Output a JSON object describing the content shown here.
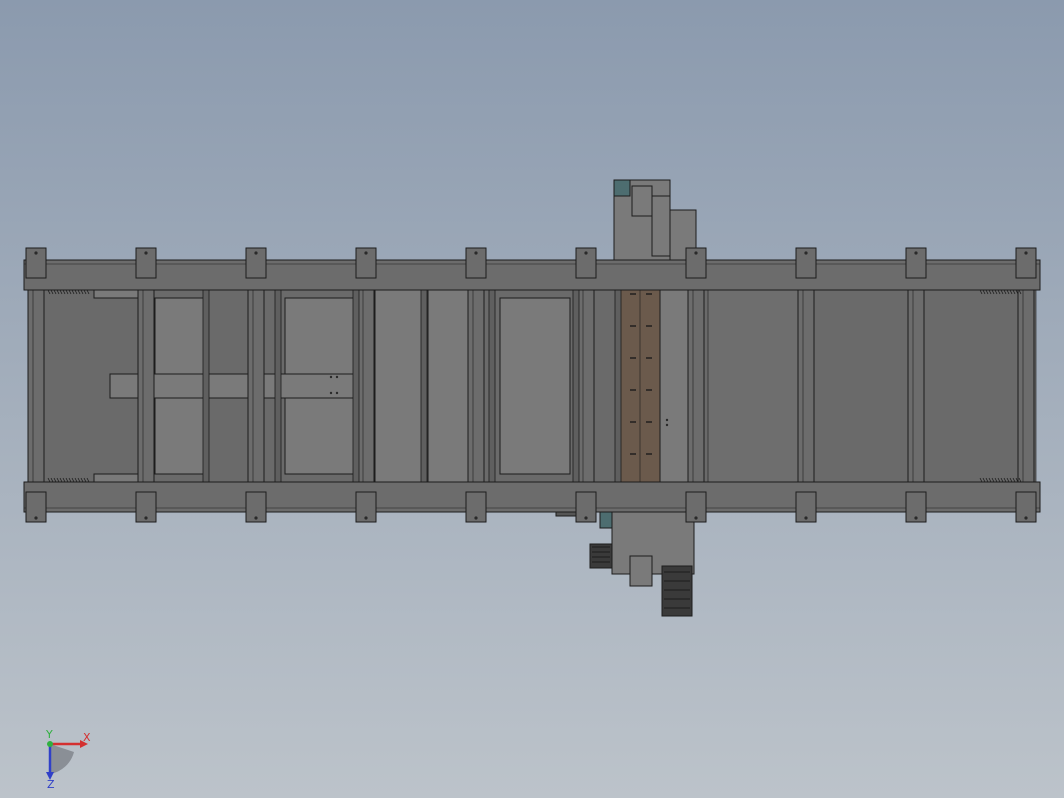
{
  "viewport": {
    "background_top": "#8b9aae",
    "background_bottom": "#bcc3ca"
  },
  "model": {
    "frame_color": "#6c6c6c",
    "panel_color": "#7a7a7a",
    "edge_color": "#1c1c1c",
    "chain_color": "#6b5a4c",
    "accent_color": "#4d6d70"
  },
  "triad": {
    "x_label": "X",
    "y_label": "Y",
    "z_label": "Z",
    "x_color": "#d43030",
    "y_color": "#30b040",
    "z_color": "#3040c8"
  }
}
